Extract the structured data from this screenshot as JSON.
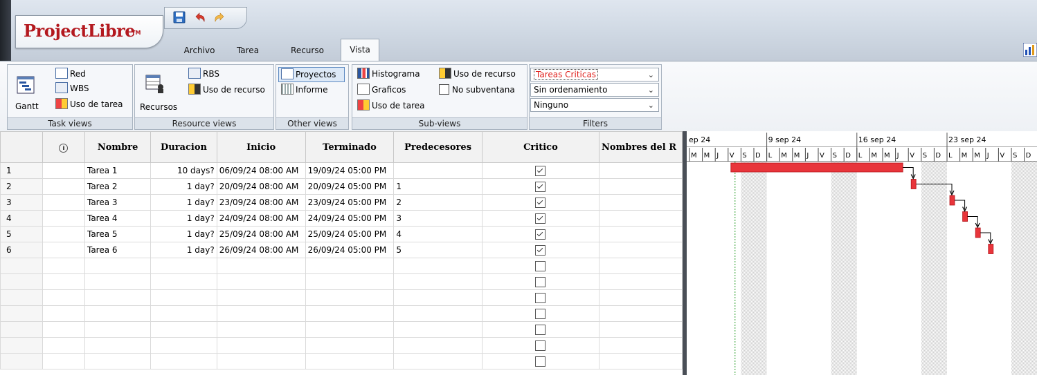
{
  "app": {
    "logo": "ProjectLibre",
    "logo_tm": "TM"
  },
  "quick_access": {
    "icons": [
      "save-icon",
      "undo-icon",
      "redo-icon"
    ]
  },
  "menu_tabs": [
    {
      "label": "Archivo",
      "active": false
    },
    {
      "label": "Tarea",
      "active": false
    },
    {
      "label": "Recurso",
      "active": false
    },
    {
      "label": "Vista",
      "active": true
    }
  ],
  "ribbon": {
    "task_views": {
      "label": "Task views",
      "gantt": "Gantt",
      "red": "Red",
      "wbs": "WBS",
      "uso_tarea": "Uso de tarea"
    },
    "resource_views": {
      "label": "Resource views",
      "recursos": "Recursos",
      "rbs": "RBS",
      "uso_recurso": "Uso de recurso"
    },
    "other_views": {
      "label": "Other views",
      "proyectos": "Proyectos",
      "informe": "Informe"
    },
    "sub_views": {
      "label": "Sub-views",
      "histograma": "Histograma",
      "graficos": "Graficos",
      "uso_tarea": "Uso de tarea",
      "uso_recurso": "Uso de recurso",
      "no_subventana": "No subventana",
      "no_subventana_checked": false
    },
    "filters": {
      "label": "Filters",
      "filter": "Tareas Criticas",
      "sort": "Sin ordenamiento",
      "group": "Ninguno"
    }
  },
  "table": {
    "headers": [
      "",
      "",
      "Nombre",
      "Duracion",
      "Inicio",
      "Terminado",
      "Predecesores",
      "Critico",
      "Nombres del R"
    ],
    "rows": [
      {
        "num": "1",
        "name": "Tarea 1",
        "duration": "10 days?",
        "start": "06/09/24 08:00 AM",
        "finish": "19/09/24 05:00 PM",
        "pred": "",
        "critical": true
      },
      {
        "num": "2",
        "name": "Tarea 2",
        "duration": "1 day?",
        "start": "20/09/24 08:00 AM",
        "finish": "20/09/24 05:00 PM",
        "pred": "1",
        "critical": true
      },
      {
        "num": "3",
        "name": "Tarea 3",
        "duration": "1 day?",
        "start": "23/09/24 08:00 AM",
        "finish": "23/09/24 05:00 PM",
        "pred": "2",
        "critical": true
      },
      {
        "num": "4",
        "name": "Tarea 4",
        "duration": "1 day?",
        "start": "24/09/24 08:00 AM",
        "finish": "24/09/24 05:00 PM",
        "pred": "3",
        "critical": true
      },
      {
        "num": "5",
        "name": "Tarea 5",
        "duration": "1 day?",
        "start": "25/09/24 08:00 AM",
        "finish": "25/09/24 05:00 PM",
        "pred": "4",
        "critical": true
      },
      {
        "num": "6",
        "name": "Tarea 6",
        "duration": "1 day?",
        "start": "26/09/24 08:00 AM",
        "finish": "26/09/24 05:00 PM",
        "pred": "5",
        "critical": true
      }
    ],
    "empty_rows": 7
  },
  "gantt": {
    "week_labels": [
      "ep 24",
      "9 sep 24",
      "16 sep 24",
      "23 sep 24"
    ],
    "day_letters": [
      "M",
      "M",
      "J",
      "V",
      "S",
      "D",
      "L",
      "M",
      "M",
      "J",
      "V",
      "S",
      "D",
      "L",
      "M",
      "M",
      "J",
      "V",
      "S",
      "D",
      "L",
      "M",
      "M",
      "J",
      "V",
      "S",
      "D"
    ],
    "bar_color": "#e8353b",
    "first_day": "2024-09-03",
    "tasks": [
      {
        "start_day": "2024-09-06",
        "end_day": "2024-09-19"
      },
      {
        "start_day": "2024-09-20",
        "end_day": "2024-09-20"
      },
      {
        "start_day": "2024-09-23",
        "end_day": "2024-09-23"
      },
      {
        "start_day": "2024-09-24",
        "end_day": "2024-09-24"
      },
      {
        "start_day": "2024-09-25",
        "end_day": "2024-09-25"
      },
      {
        "start_day": "2024-09-26",
        "end_day": "2024-09-26"
      }
    ]
  }
}
